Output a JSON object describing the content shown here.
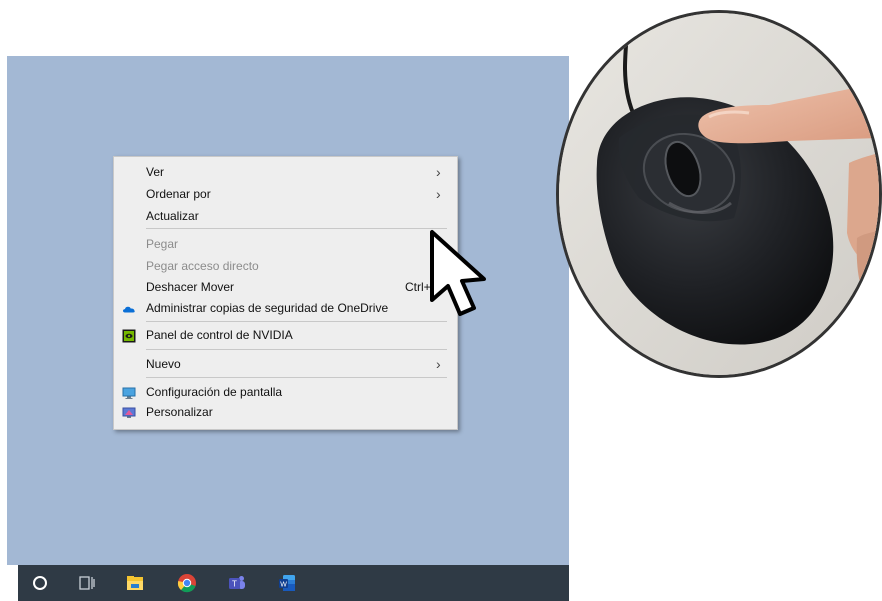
{
  "context_menu": {
    "items": [
      {
        "label": "Ver",
        "has_submenu": true,
        "enabled": true
      },
      {
        "label": "Ordenar por",
        "has_submenu": true,
        "enabled": true
      },
      {
        "label": "Actualizar",
        "enabled": true
      },
      {
        "label": "Pegar",
        "enabled": false
      },
      {
        "label": "Pegar acceso directo",
        "enabled": false
      },
      {
        "label": "Deshacer Mover",
        "shortcut": "Ctrl+",
        "enabled": true
      },
      {
        "label": "Administrar copias de seguridad de OneDrive",
        "icon": "onedrive-cloud-icon",
        "enabled": true
      },
      {
        "label": "Panel de control de NVIDIA",
        "icon": "nvidia-icon",
        "enabled": true
      },
      {
        "label": "Nuevo",
        "has_submenu": true,
        "enabled": true
      },
      {
        "label": "Configuración de pantalla",
        "icon": "display-settings-icon",
        "enabled": true
      },
      {
        "label": "Personalizar",
        "icon": "personalize-icon",
        "enabled": true
      }
    ]
  },
  "taskbar": {
    "icons": [
      "search-circle-icon",
      "task-view-icon",
      "file-explorer-icon",
      "chrome-icon",
      "teams-icon",
      "word-icon"
    ]
  },
  "photo": {
    "subject": "mouse-with-finger-photo"
  },
  "colors": {
    "desktop": "#a3b8d4",
    "menu_bg": "#eeeeee",
    "taskbar": "#2f3a45",
    "onedrive": "#0a6fd6",
    "nvidia": "#76b900"
  }
}
